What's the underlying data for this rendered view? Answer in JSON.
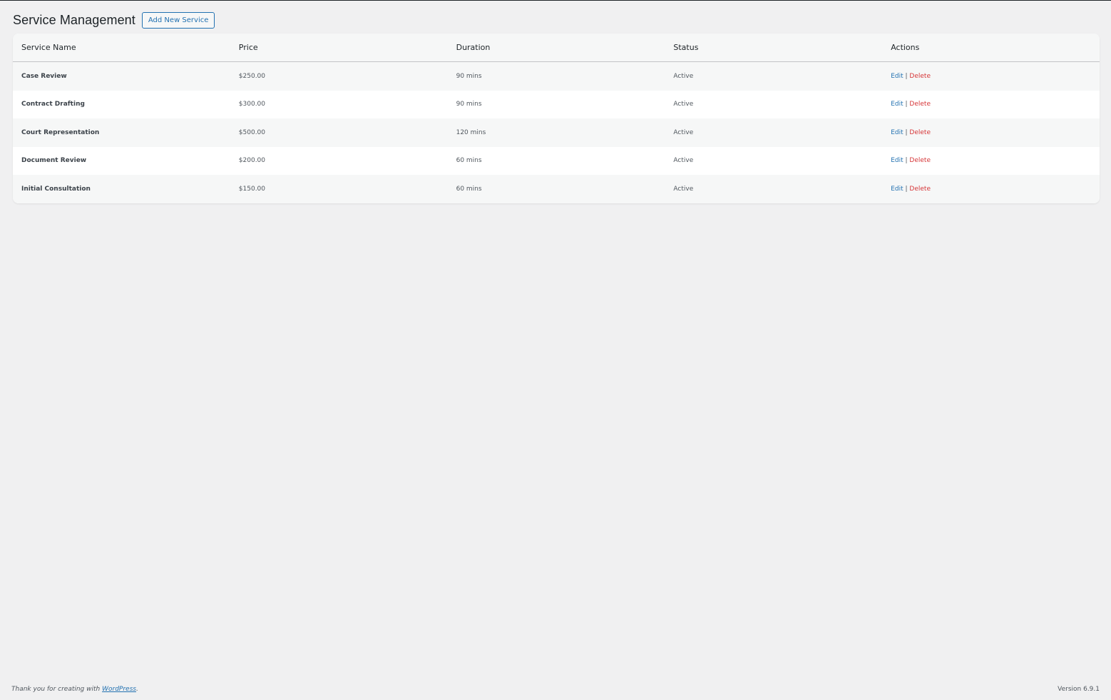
{
  "header": {
    "title": "Service Management",
    "add_button": "Add New Service"
  },
  "table": {
    "columns": [
      "Service Name",
      "Price",
      "Duration",
      "Status",
      "Actions"
    ],
    "rows": [
      {
        "name": "Case Review",
        "price": "$250.00",
        "duration": "90 mins",
        "status": "Active"
      },
      {
        "name": "Contract Drafting",
        "price": "$300.00",
        "duration": "90 mins",
        "status": "Active"
      },
      {
        "name": "Court Representation",
        "price": "$500.00",
        "duration": "120 mins",
        "status": "Active"
      },
      {
        "name": "Document Review",
        "price": "$200.00",
        "duration": "60 mins",
        "status": "Active"
      },
      {
        "name": "Initial Consultation",
        "price": "$150.00",
        "duration": "60 mins",
        "status": "Active"
      }
    ],
    "edit_label": "Edit",
    "separator": "|",
    "delete_label": "Delete"
  },
  "footer": {
    "thanks_prefix": "Thank you for creating with ",
    "wordpress_link": "WordPress",
    "thanks_suffix": ".",
    "version": "Version 6.9.1"
  }
}
